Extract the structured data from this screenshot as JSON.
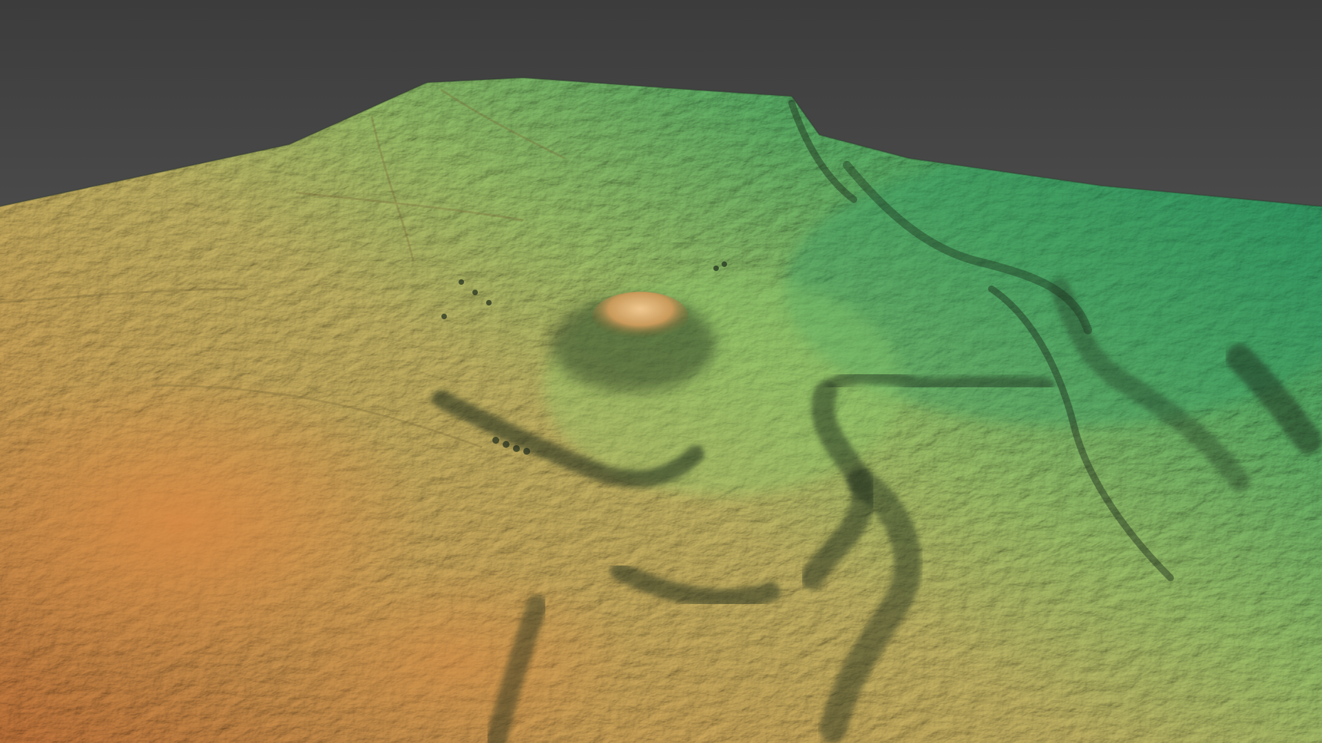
{
  "scene": {
    "subject": "shaded-relief-terrain-model",
    "colors": {
      "background_top": "#3c3c3c",
      "background_bottom": "#6e6e6e",
      "low_elevation": "#c8783c",
      "mid_low_elevation": "#d2a85a",
      "mid_elevation": "#b4c46a",
      "mid_high_elevation": "#6fbf6a",
      "high_elevation": "#2f9a66",
      "shadow": "#1c2a1c"
    }
  }
}
